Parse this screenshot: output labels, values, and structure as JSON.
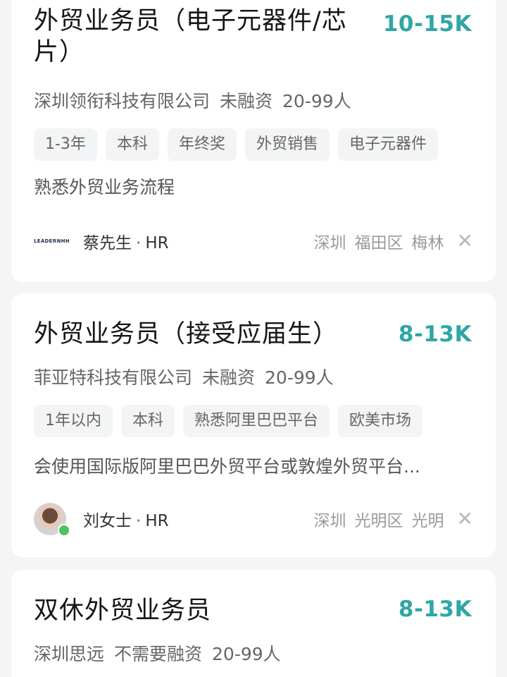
{
  "jobs": [
    {
      "title": "外贸业务员（电子元器件/芯片）",
      "salary": "10-15K",
      "company": "深圳领衔科技有限公司",
      "funding": "未融资",
      "size": "20-99人",
      "tags": [
        "1-3年",
        "本科",
        "年终奖",
        "外贸销售",
        "电子元器件"
      ],
      "desc": "熟悉外贸业务流程",
      "logo_text": "LEADERNHH",
      "recruiter": "蔡先生",
      "role": "HR",
      "location": [
        "深圳",
        "福田区",
        "梅林"
      ]
    },
    {
      "title": "外贸业务员（接受应届生）",
      "salary": "8-13K",
      "company": "菲亚特科技有限公司",
      "funding": "未融资",
      "size": "20-99人",
      "tags": [
        "1年以内",
        "本科",
        "熟悉阿里巴巴平台",
        "欧美市场"
      ],
      "desc": "会使用国际版阿里巴巴外贸平台或敦煌外贸平台...",
      "recruiter": "刘女士",
      "role": "HR",
      "location": [
        "深圳",
        "光明区",
        "光明"
      ]
    },
    {
      "title": "双休外贸业务员",
      "salary": "8-13K",
      "company": "深圳思远",
      "funding": "不需要融资",
      "size": "20-99人"
    }
  ],
  "icons": {
    "close": "close-icon"
  },
  "colors": {
    "salary": "#2fa7a4",
    "online": "#4cc45a"
  }
}
